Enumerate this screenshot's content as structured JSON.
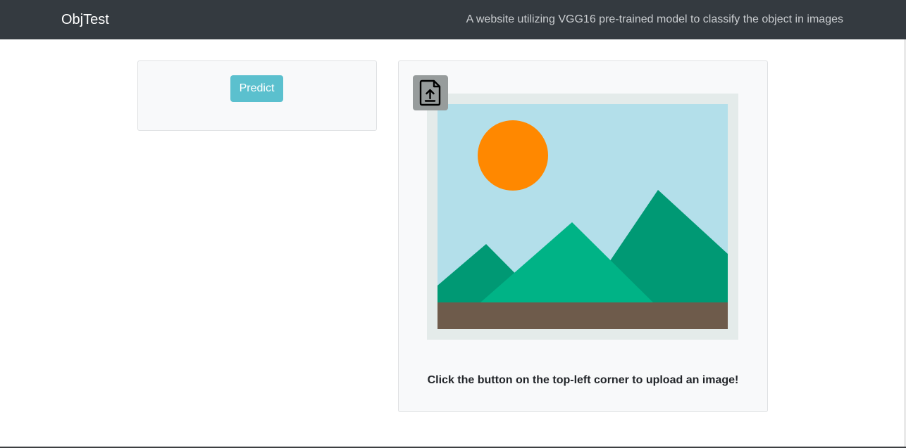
{
  "navbar": {
    "brand": "ObjTest",
    "tagline": "A website utilizing VGG16 pre-trained model to classify the object in images"
  },
  "controls": {
    "predict_label": "Predict"
  },
  "upload": {
    "icon": "file-upload-icon",
    "placeholder_image": "landscape-placeholder-image",
    "hint": "Click the button on the top-left corner to upload an image!"
  },
  "colors": {
    "navbar_bg": "#343a40",
    "predict_button": "#5bc0ce",
    "upload_button": "#979c9c",
    "card_bg": "#f8f9fa",
    "sky": "#b3dfea",
    "sun": "#ff8800",
    "mountain_dark": "#009974",
    "mountain_light": "#00b386",
    "ground": "#6e5b4b"
  }
}
